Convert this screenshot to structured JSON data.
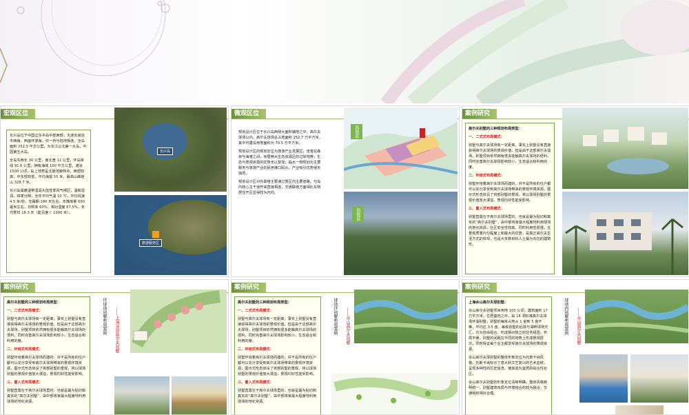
{
  "sheets": [
    {
      "tag": "宏观区位",
      "paragraphs": [
        "长兴岛位于中国辽东半岛中部西部，大连瓦房店市西南，西面环渤海，仅一桥与陆地相连，全岛面积 252.5 平方公里，为长江以北第一大岛，中国第五大岛。",
        "全岛东西长 30 公里，南北宽 11 公里，环岛岸线 91.6 公里，拥有海域 100 平方公里，滩涂 1500 公顷，岛上地势呈北陡地貌特点，西部较高，中东部较低，平均海拔 55 米，最高山峰塔山 328.7 米。",
        "长兴岛属暖温带湿润大陆性季风气候区，温和湿润，四季分明，全年平均气温 10 ℃，平均风速 4.5 米/秒，无霜期 180 天左右，年降雨量 600 毫米左右，日照率 60%，相对湿度 67.5%，年均雾日 18.3 天（能见度＜ 1000 米）。"
      ],
      "map_labels": [
        "长兴岛",
        "旅游服务区"
      ]
    },
    {
      "tag": "微观区位",
      "paragraphs": [
        "规划设计区位于长兴岛西侧大面积辅地之中，高尔夫球场以内，高尔夫球场总占地面积 252.7 万平方米，其中可建设用地面积为 70.5 万平方米。",
        "规划设计区的规划定位为旅游产业发展区，坐落在森林与海滩之间，身居两大生态资源区的过际地带，生态与景观资源的优势无以复加；临水一侧规划为主要服务与旅游产业的民用港口码头，产业吸引优势得天独厚。",
        "规划设计区对外联络主要通过景区内主要道路，与岛内核心主干道开来直接相连，交通联络方面相比东侧居住开区显得较为内向。"
      ],
      "map_labels": [
        "风险区",
        "风险区"
      ]
    },
    {
      "tag": "案例研究",
      "title": "高尔夫别墅的三种规划布局类型：",
      "sections": [
        {
          "heading": "一、二式式布局模式：",
          "text": "别墅与高尔夫球场有一定距离，事实上别墅没有直接获得高尔夫球场的景观价值，但是由于这部高尔夫球场，别墅项目依然拥有很多能触高尔夫球场的便利，同时完善高尔夫球场影响较小，生态适合和利用的度。"
        },
        {
          "heading": "二、环绕式布局模式：",
          "text": "别墅环绕着高尔夫球场而建的，并不是所有的住户都可以充分享受到高尔夫球场带来的景观环境资源，图示式形态体设了将部别墅的景观，将以球场别墅的景观价值放大漫溢，景观均好性能受影响。"
        },
        {
          "heading": "三、置入式布局模式：",
          "text": "别墅直置在于高尔夫球场里的，也就是最为贴切和真实的“高尔夫别墅”，由中部将家最大程度地利用球场的地化资源，社区安全性较高，同时利用性很强，在景观质量均匀程度上和最大的优势，是真正高尔夫生活方式的体现，也是大多数目标人士最为向往的建筑形。"
        }
      ]
    },
    {
      "tag": "案例研究",
      "title": "高尔夫别墅的三种规划布局类型：",
      "sections": [
        {
          "heading": "一、二式式布局模式：",
          "text": "别墅与高尔夫球场有一定距离，事实上别墅没有直接获得高尔夫球场的景观价值，但是由于这部高尔夫球场，别墅项目依然拥有很多能触高尔夫球场的便利，同时完善高尔夫球场影响较小，生态适合和利用的度。"
        },
        {
          "heading": "二、环绕式布局模式：",
          "text": "别墅环绕着高尔夫球场而建的，并不是所有的住户都可以充分享受到高尔夫球场带来的景观环境资源，图示式形态体设了将部别墅的景观，将以球场别墅的景观价值放大漫溢，景观均好性能受影响。"
        },
        {
          "heading": "三、置入式布局模式：",
          "text": "别墅直置在于高尔夫球场里的，也就是最为贴切和真实的“高尔夫别墅”，由中部将家最大程度地利用球场的地化资源。"
        }
      ],
      "vertical_labels": [
        "环球场别墅布局案例",
        "——上海深圳高尔夫别墅"
      ]
    },
    {
      "tag": "案例研究",
      "title": "高尔夫别墅的三种规划布局类型：",
      "sections": [
        {
          "heading": "一、二式式布局模式：",
          "text": "别墅与高尔夫球场有一定距离，事实上别墅没有直接获得高尔夫球场的景观价值，但是由于这部高尔夫球场，别墅项目依然拥有很多能触高尔夫球场的便利，同时完善高尔夫球场影响较小，生态适合和利用的度。"
        },
        {
          "heading": "二、环绕式布局模式：",
          "text": "别墅环绕着高尔夫球场而建的，并不是所有的住户都可以充分享受到高尔夫球场带来的景观环境资源，图示式形态体设了将部别墅的景观，将以球场别墅的景观价值放大漫溢，景观均好性能受影响。"
        },
        {
          "heading": "三、置入式布局模式：",
          "text": "别墅直置在于高尔夫球场里的，也就是最为贴切和真实的“高尔夫别墅”，由中部将家最大程度地利用球场的地化资源。"
        }
      ],
      "vertical_labels": [
        "球场环别墅布局案例",
        "——佘山高尔夫别墅"
      ]
    },
    {
      "tag": "案例研究",
      "title": "上海佘山高尔夫球别墅：",
      "paragraphs": [
        "佘山高尔夫别墅项目用地 100 公顷，建筑面积 17 万平方米，位居基地之中，由 18 洞标准高尔夫球场环湖别墅，别墅的每栋占地从 1 亩到 5 亩不等，平均达 3.5 亩，每栋别墅的后院与湖畔球场交汇，均为自由组合，形成相对独立的住宅组团，布局平缓，别墅的间距在不同的地势上形成景观层次，同时保证每个业主都享受高尔夫球场的景观资源。",
        "佘山高尔夫球别墅的整体形象定位为托斯卡纳风格，托斯卡纳标示了意大利文艺复兴的艺术血统，呈现多种性的历史信息，使其成为宜居的综合性社区。",
        "佘山高尔夫别墅的形象定位清晰明确，整体风格鲜明统一，别墅建筑布局与环境结合的较为融洽，交通组织相对合理。"
      ],
      "vertical_labels": [
        "球场内别墅布局案例",
        "——佘山高尔夫别墅"
      ]
    }
  ],
  "colors": {
    "tag_green": "#6d8f3f",
    "box_border": "#7aa64a",
    "highlight_red": "#d02020"
  }
}
